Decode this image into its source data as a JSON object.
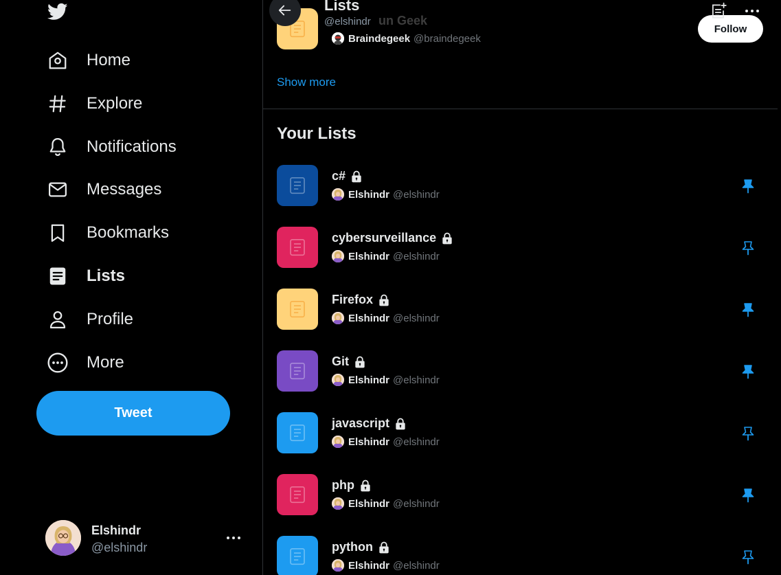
{
  "sidebar": {
    "nav": [
      {
        "label": "Home",
        "icon": "home-icon"
      },
      {
        "label": "Explore",
        "icon": "hashtag-icon"
      },
      {
        "label": "Notifications",
        "icon": "bell-icon"
      },
      {
        "label": "Messages",
        "icon": "envelope-icon"
      },
      {
        "label": "Bookmarks",
        "icon": "bookmark-icon"
      },
      {
        "label": "Lists",
        "icon": "lists-icon",
        "active": true
      },
      {
        "label": "Profile",
        "icon": "person-icon"
      },
      {
        "label": "More",
        "icon": "more-circle-icon"
      }
    ],
    "tweet_label": "Tweet",
    "account": {
      "name": "Elshindr",
      "handle": "@elshindr"
    }
  },
  "header": {
    "title": "Lists",
    "subtitle": "@elshindr"
  },
  "suggested": {
    "title": "un Geek",
    "owner_name": "Braindegeek",
    "owner_handle": "@braindegeek",
    "follow_label": "Follow",
    "show_more": "Show more"
  },
  "your_lists": {
    "title": "Your Lists",
    "items": [
      {
        "name": "c#",
        "owner": "Elshindr",
        "handle": "@elshindr",
        "color": "#0b4c9c",
        "pinned": true
      },
      {
        "name": "cybersurveillance",
        "owner": "Elshindr",
        "handle": "@elshindr",
        "color": "#e0245e",
        "pinned": false
      },
      {
        "name": "Firefox",
        "owner": "Elshindr",
        "handle": "@elshindr",
        "color": "#ffd37a",
        "pinned": true
      },
      {
        "name": "Git",
        "owner": "Elshindr",
        "handle": "@elshindr",
        "color": "#794bc4",
        "pinned": true
      },
      {
        "name": "javascript",
        "owner": "Elshindr",
        "handle": "@elshindr",
        "color": "#1d9bf0",
        "pinned": false
      },
      {
        "name": "php",
        "owner": "Elshindr",
        "handle": "@elshindr",
        "color": "#e0245e",
        "pinned": true
      },
      {
        "name": "python",
        "owner": "Elshindr",
        "handle": "@elshindr",
        "color": "#1d9bf0",
        "pinned": false
      }
    ]
  },
  "colors": {
    "accent": "#1d9bf0",
    "background": "#000000",
    "border": "#2f3336"
  }
}
